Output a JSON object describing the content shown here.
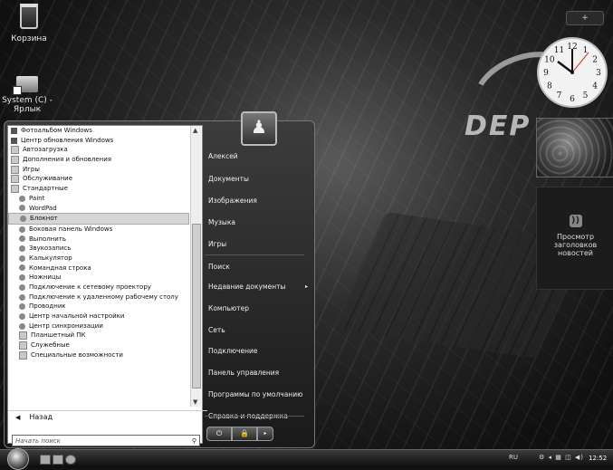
{
  "desktop": {
    "icons": [
      {
        "label": "Корзина"
      },
      {
        "label": "System (C) - Ярлык"
      }
    ],
    "brand_text": "DEP"
  },
  "gadgets": {
    "top_button": "+",
    "clock_numbers": [
      "12",
      "1",
      "2",
      "3",
      "4",
      "5",
      "6",
      "7",
      "8",
      "9",
      "10",
      "11"
    ],
    "rss_label": "Просмотр заголовков новостей",
    "rss_icon": "rss-icon"
  },
  "start_menu": {
    "programs": [
      {
        "label": "Фотоальбом Windows",
        "level": 0,
        "icon": "photo-icon"
      },
      {
        "label": "Центр обновления Windows",
        "level": 0,
        "icon": "update-icon"
      },
      {
        "label": "Автозагрузка",
        "level": 0,
        "icon": "folder-icon"
      },
      {
        "label": "Дополнения и обновления",
        "level": 0,
        "icon": "folder-icon"
      },
      {
        "label": "Игры",
        "level": 0,
        "icon": "folder-icon"
      },
      {
        "label": "Обслуживание",
        "level": 0,
        "icon": "folder-icon"
      },
      {
        "label": "Стандартные",
        "level": 0,
        "icon": "folder-icon"
      },
      {
        "label": "Paint",
        "level": 1,
        "icon": "paint-icon"
      },
      {
        "label": "WordPad",
        "level": 1,
        "icon": "wordpad-icon"
      },
      {
        "label": "Блокнот",
        "level": 1,
        "icon": "notepad-icon",
        "selected": true
      },
      {
        "label": "Боковая панель Windows",
        "level": 1,
        "icon": "sidebar-icon"
      },
      {
        "label": "Выполнить",
        "level": 1,
        "icon": "run-icon"
      },
      {
        "label": "Звукозапись",
        "level": 1,
        "icon": "microphone-icon"
      },
      {
        "label": "Калькулятор",
        "level": 1,
        "icon": "calculator-icon"
      },
      {
        "label": "Командная строка",
        "level": 1,
        "icon": "cmd-icon"
      },
      {
        "label": "Ножницы",
        "level": 1,
        "icon": "scissors-icon"
      },
      {
        "label": "Подключение к сетевому проектору",
        "level": 1,
        "icon": "projector-icon"
      },
      {
        "label": "Подключение к удаленному рабочему столу",
        "level": 1,
        "icon": "remote-desktop-icon"
      },
      {
        "label": "Проводник",
        "level": 1,
        "icon": "explorer-icon"
      },
      {
        "label": "Центр начальной настройки",
        "level": 1,
        "icon": "welcome-icon"
      },
      {
        "label": "Центр синхронизации",
        "level": 1,
        "icon": "sync-icon"
      },
      {
        "label": "Планшетный ПК",
        "level": 1,
        "icon": "folder-icon"
      },
      {
        "label": "Служебные",
        "level": 1,
        "icon": "folder-icon"
      },
      {
        "label": "Специальные возможности",
        "level": 1,
        "icon": "folder-icon"
      }
    ],
    "back_label": "Назад",
    "search_placeholder": "Начать поиск",
    "right_items": [
      {
        "label": "Алексей"
      },
      {
        "label": "Документы"
      },
      {
        "label": "Изображения"
      },
      {
        "label": "Музыка"
      },
      {
        "label": "Игры"
      },
      {
        "label": "Поиск"
      },
      {
        "label": "Недавние документы",
        "submenu": "▸"
      },
      {
        "label": "Компьютер"
      },
      {
        "label": "Сеть"
      },
      {
        "label": "Подключение"
      },
      {
        "label": "Панель управления"
      },
      {
        "label": "Программы по умолчанию"
      },
      {
        "label": "Справка и поддержка"
      }
    ],
    "power_symbol": "⏻",
    "lock_symbol": "🔒",
    "more_symbol": "▸"
  },
  "taskbar": {
    "language": "RU",
    "tray_icons": "⚙ ◂ ▦ ◫ ◀)",
    "time": "12:52"
  }
}
